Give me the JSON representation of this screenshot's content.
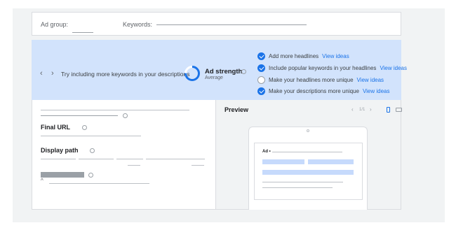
{
  "top": {
    "ad_group_label": "Ad group:",
    "keywords_label": "Keywords:"
  },
  "banner": {
    "message": "Try including more keywords in your descriptions",
    "strength_title": "Ad strength",
    "strength_value": "Average",
    "suggestions": [
      {
        "label": "Add more headlines",
        "action": "View ideas",
        "checked": true
      },
      {
        "label": "Include popular keywords in your headlines",
        "action": "View ideas",
        "checked": true
      },
      {
        "label": "Make your headlines more unique",
        "action": "View ideas",
        "checked": false
      },
      {
        "label": "Make your descriptions more unique",
        "action": "View ideas",
        "checked": true
      }
    ]
  },
  "form": {
    "final_url_label": "Final URL",
    "display_path_label": "Display path"
  },
  "preview": {
    "title": "Preview",
    "ad_label": "Ad •",
    "page_indicator": "1/1"
  },
  "colors": {
    "accent": "#1a73e8",
    "banner_bg": "#d2e3fc",
    "placeholder_bar": "#c6dafc"
  },
  "ad_strength_progress": 0.75
}
